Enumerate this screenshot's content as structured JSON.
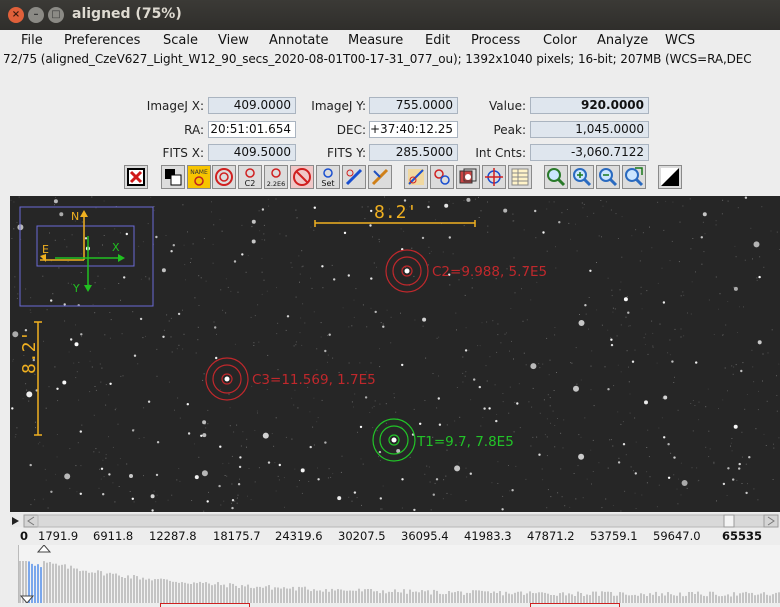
{
  "window": {
    "title": "aligned (75%)",
    "close_glyph": "×",
    "min_glyph": "–",
    "max_glyph": "□"
  },
  "menu": {
    "items": [
      "File",
      "Preferences",
      "Scale",
      "View",
      "Annotate",
      "Measure",
      "Edit",
      "Process",
      "Color",
      "Analyze",
      "WCS"
    ]
  },
  "info_line": "72/75 (aligned_CzeV627_Light_W12_90_secs_2020-08-01T00-17-31_077_ou); 1392x1040 pixels; 16-bit; 207MB (WCS=RA,DEC",
  "coords": {
    "imagej_x_label": "ImageJ X:",
    "imagej_x": "409.0000",
    "imagej_y_label": "ImageJ Y:",
    "imagej_y": "755.0000",
    "value_label": "Value:",
    "value": "920.0000",
    "ra_label": "RA:",
    "ra": "20:51:01.654",
    "dec_label": "DEC:",
    "dec": "+37:40:12.25",
    "peak_label": "Peak:",
    "peak": "1,045.0000",
    "fits_x_label": "FITS X:",
    "fits_x": "409.5000",
    "fits_y_label": "FITS Y:",
    "fits_y": "285.5000",
    "int_cnts_label": "Int Cnts:",
    "int_cnts": "-3,060.7122"
  },
  "toolbar": {
    "name_label": "NAME",
    "c2_label": "C2",
    "zeros_label": "2.2E6",
    "set_label": "Set"
  },
  "image": {
    "scale_bar_label": "8.2'",
    "scale_bar_vertical_label": "8.2'",
    "compass_n": "N",
    "compass_e": "E",
    "compass_x": "X",
    "compass_y": "Y",
    "apertures": [
      {
        "label": "C2=9.988, 5.7E5",
        "color": "#c0282c"
      },
      {
        "label": "C3=11.569, 1.7E5",
        "color": "#c0282c"
      },
      {
        "label": "T1=9.7, 7.8E5",
        "color": "#22c428"
      }
    ]
  },
  "histogram": {
    "tick_labels": [
      "0",
      "1791.9",
      "6911.8",
      "12287.8",
      "18175.7",
      "24319.6",
      "30207.5",
      "36095.4",
      "41983.3",
      "47871.2",
      "53759.1",
      "59647.0",
      "65535"
    ],
    "highlight_color": "#7aa7ec",
    "bar_color": "#c4c4c4"
  }
}
